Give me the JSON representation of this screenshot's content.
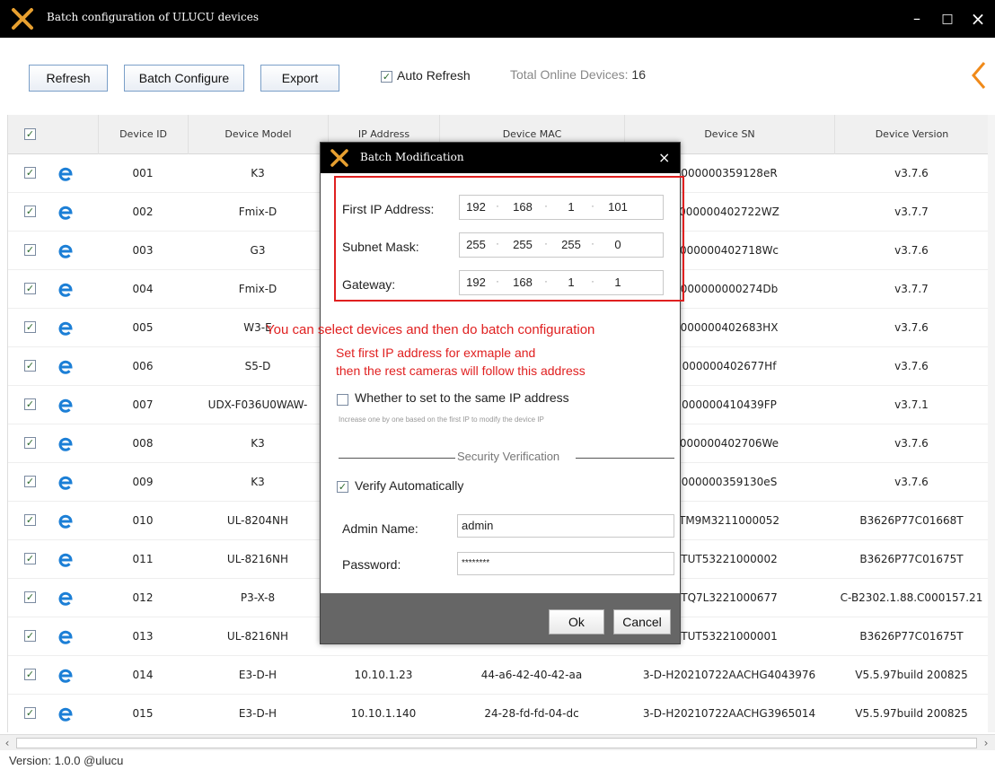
{
  "window": {
    "title": "Batch configuration of ULUCU devices",
    "minimize": "–",
    "maximize": "□",
    "close": "×",
    "brand_color": "#e8a030"
  },
  "toolbar": {
    "refresh_label": "Refresh",
    "batch_configure_label": "Batch Configure",
    "export_label": "Export",
    "auto_refresh_label": "Auto Refresh",
    "auto_refresh_checked": true,
    "online_label": "Total Online Devices:",
    "online_count": "16",
    "accent_color": "#f08a1a"
  },
  "table": {
    "headers": [
      "Device ID",
      "Device Model",
      "IP Address",
      "Device MAC",
      "Device SN",
      "Device Version"
    ],
    "rows": [
      {
        "id": "001",
        "model": "K3",
        "ip": "",
        "mac": "",
        "sn": "000000359128eR",
        "version": "v3.7.6"
      },
      {
        "id": "002",
        "model": "Fmix-D",
        "ip": "",
        "mac": "",
        "sn": "000000402722WZ",
        "version": "v3.7.7"
      },
      {
        "id": "003",
        "model": "G3",
        "ip": "",
        "mac": "",
        "sn": "000000402718Wc",
        "version": "v3.7.6"
      },
      {
        "id": "004",
        "model": "Fmix-D",
        "ip": "",
        "mac": "",
        "sn": "000000000274Db",
        "version": "v3.7.7"
      },
      {
        "id": "005",
        "model": "W3-E",
        "ip": "",
        "mac": "",
        "sn": "000000402683HX",
        "version": "v3.7.6"
      },
      {
        "id": "006",
        "model": "S5-D",
        "ip": "",
        "mac": "",
        "sn": "000000402677Hf",
        "version": "v3.7.6"
      },
      {
        "id": "007",
        "model": "UDX-F036U0WAW-",
        "ip": "",
        "mac": "",
        "sn": "000000410439FP",
        "version": "v3.7.1"
      },
      {
        "id": "008",
        "model": "K3",
        "ip": "",
        "mac": "",
        "sn": "000000402706We",
        "version": "v3.7.6"
      },
      {
        "id": "009",
        "model": "K3",
        "ip": "",
        "mac": "",
        "sn": "000000359130eS",
        "version": "v3.7.6"
      },
      {
        "id": "010",
        "model": "UL-8204NH",
        "ip": "",
        "mac": "",
        "sn": "TM9M3211000052",
        "version": "B3626P77C01668T"
      },
      {
        "id": "011",
        "model": "UL-8216NH",
        "ip": "",
        "mac": "",
        "sn": "TUT53221000002",
        "version": "B3626P77C01675T"
      },
      {
        "id": "012",
        "model": "P3-X-8",
        "ip": "",
        "mac": "",
        "sn": "TQ7L3221000677",
        "version": "C-B2302.1.88.C000157.21"
      },
      {
        "id": "013",
        "model": "UL-8216NH",
        "ip": "",
        "mac": "",
        "sn": "TUT53221000001",
        "version": "B3626P77C01675T"
      },
      {
        "id": "014",
        "model": "E3-D-H",
        "ip": "10.10.1.23",
        "mac": "44-a6-42-40-42-aa",
        "sn": "3-D-H20210722AACHG4043976",
        "version": "V5.5.97build 200825"
      },
      {
        "id": "015",
        "model": "E3-D-H",
        "ip": "10.10.1.140",
        "mac": "24-28-fd-fd-04-dc",
        "sn": "3-D-H20210722AACHG3965014",
        "version": "V5.5.97build 200825"
      }
    ]
  },
  "footer": {
    "version": "Version: 1.0.0 @ulucu"
  },
  "dialog": {
    "title": "Batch Modification",
    "close": "×",
    "first_ip_label": "First IP Address:",
    "first_ip": [
      "192",
      "168",
      "1",
      "101"
    ],
    "subnet_label": "Subnet Mask:",
    "subnet": [
      "255",
      "255",
      "255",
      "0"
    ],
    "gateway_label": "Gateway:",
    "gateway": [
      "192",
      "168",
      "1",
      "1"
    ],
    "annotation_1": "You can select devices and then do batch configuration",
    "annotation_2": "Set first IP address for exmaple and",
    "annotation_3": "then the rest cameras will follow this address",
    "same_ip_label": "Whether to set to the same IP address",
    "same_ip_checked": false,
    "same_ip_hint": "Increase one by one based on the first IP to modify the device IP",
    "security_label": "Security Verification",
    "verify_label": "Verify Automatically",
    "verify_checked": true,
    "admin_label": "Admin Name:",
    "admin_value": "admin",
    "password_label": "Password:",
    "password_value": "********",
    "ok_label": "Ok",
    "cancel_label": "Cancel",
    "highlight_color": "#e02020"
  }
}
